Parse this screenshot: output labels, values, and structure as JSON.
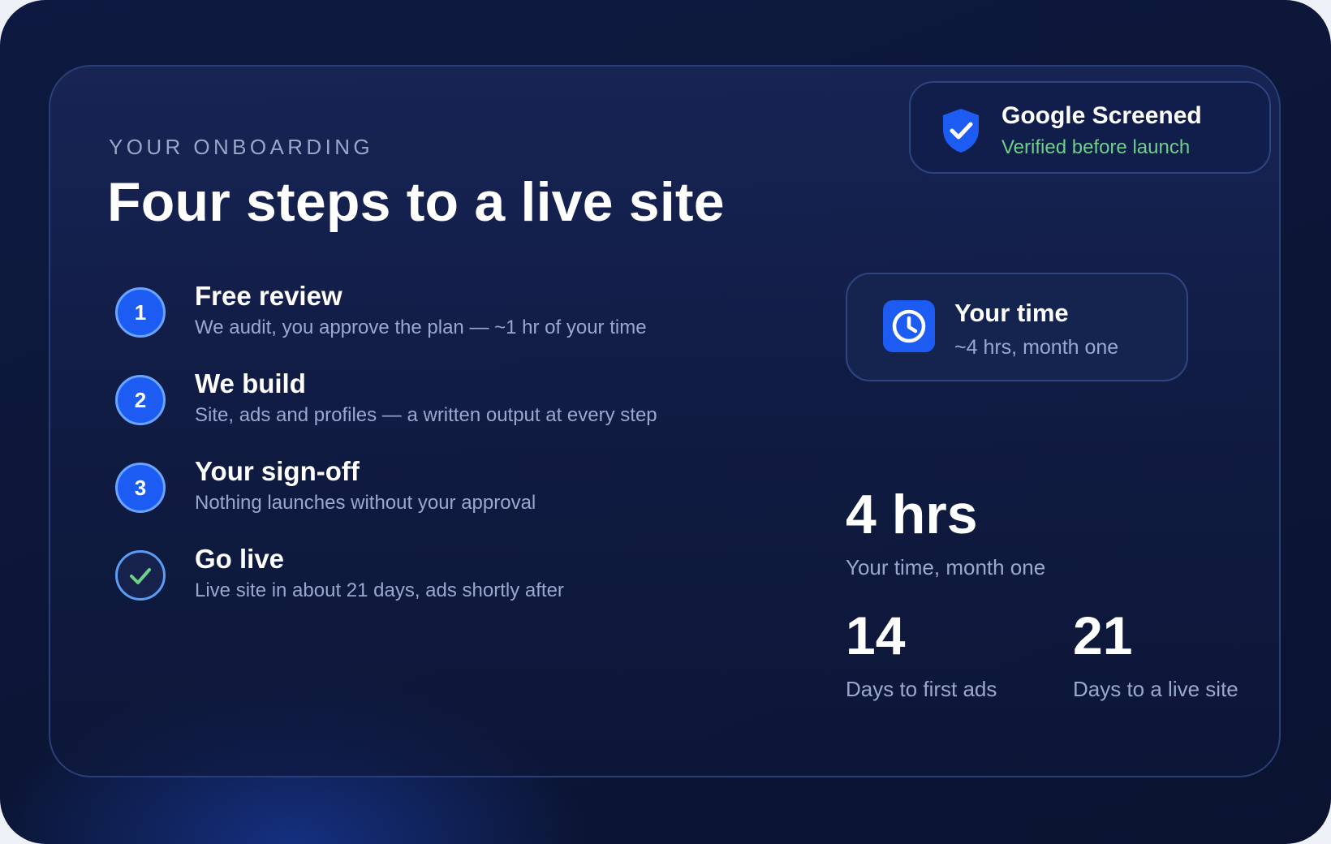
{
  "header": {
    "eyebrow": "YOUR ONBOARDING",
    "title": "Four steps to a live site"
  },
  "badge": {
    "icon": "shield-check-icon",
    "title": "Google Screened",
    "subtitle": "Verified before launch",
    "subtitle_color": "#6fd08a"
  },
  "steps": [
    {
      "marker": "1",
      "title": "Free review",
      "description": "We audit, you approve the plan — ~1 hr of your time"
    },
    {
      "marker": "2",
      "title": "We build",
      "description": "Site, ads and profiles — a written output at every step"
    },
    {
      "marker": "3",
      "title": "Your sign-off",
      "description": "Nothing launches without your approval"
    },
    {
      "marker": "check-icon",
      "title": "Go live",
      "description": "Live site in about 21 days, ads shortly after"
    }
  ],
  "time_card": {
    "icon": "clock-icon",
    "title": "Your time",
    "subtitle": "~4 hrs, month one"
  },
  "stats": {
    "primary": {
      "value": "4 hrs",
      "label": "Your time, month one"
    },
    "first_ads": {
      "value": "14",
      "label": "Days to first ads"
    },
    "live_site": {
      "value": "21",
      "label": "Days to a live site"
    }
  },
  "colors": {
    "accent": "#1d5cf2",
    "background": "#0b1637",
    "success": "#6fd08a"
  }
}
